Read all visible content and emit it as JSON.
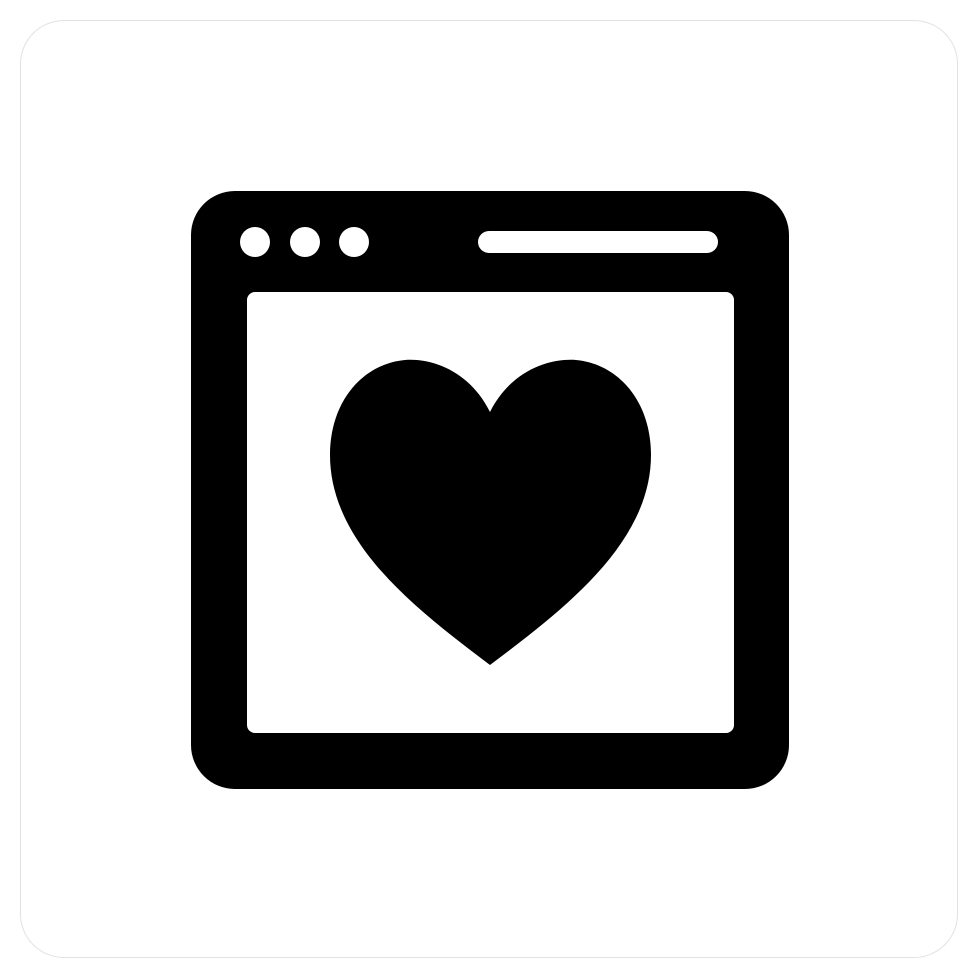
{
  "icon": {
    "name": "browser-window-heart-icon",
    "style": "solid glyph",
    "colors": {
      "foreground": "#000000",
      "background": "#ffffff",
      "card_border": "#e2e2e2"
    },
    "parts": [
      "window-frame",
      "window-control-dots",
      "address-bar",
      "content-area",
      "heart"
    ]
  }
}
